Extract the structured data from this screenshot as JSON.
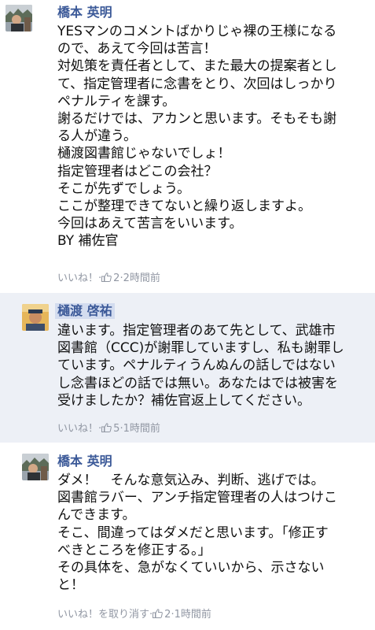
{
  "comments": [
    {
      "author": "橋本 英明",
      "lines": [
        "YESマンのコメントばかりじゃ裸の王様になる",
        "ので、あえて今回は苦言！",
        "対処策を責任者として、また最大の提案者とし",
        "て、指定管理者に念書をとり、次回はしっかり",
        "ペナルティを課す。",
        "謝るだけでは、アカンと思います。そもそも謝",
        "る人が違う。",
        "樋渡図書館じゃないでしょ！",
        "指定管理者はどこの会社？",
        "そこが先ずでしょう。",
        "ここが整理できてないと繰り返しますよ。",
        "今回はあえて苦言をいいます。",
        "BY 補佐官"
      ],
      "like_label": "いいね！",
      "likes": "2",
      "time": "2時間前"
    },
    {
      "author": "樋渡 啓祐",
      "lines": [
        "違います。指定管理者のあて先として、武雄市",
        "図書館（CCC)が謝罪していますし、私も謝罪し",
        "ています。ペナルティうんぬんの話しではない",
        "し念書ほどの話では無い。あなたはでは被害を",
        "受けましたか？補佐官返上してください。"
      ],
      "like_label": "いいね！",
      "likes": "5",
      "time": "1時間前"
    },
    {
      "author": "橋本 英明",
      "lines": [
        "ダメ！　そんな意気込み、判断、逃げでは。",
        "図書館ラバー、アンチ指定管理者の人はつけこ",
        "んできます。",
        "そこ、間違ってはダメだと思います。「修正す",
        "べきところを修正する。」",
        "その具体を、急がなくていいから、示さない",
        "と！"
      ],
      "like_label": "いいね！を取り消す",
      "likes": "2",
      "time": "1時間前"
    }
  ],
  "separator": " · ",
  "colors": {
    "author": "#3b5998",
    "highlight_bg": "#edf0f6",
    "meta": "#9197a3"
  },
  "icons": {
    "avatar": "avatar-photo",
    "like": "thumbs-up-icon"
  }
}
